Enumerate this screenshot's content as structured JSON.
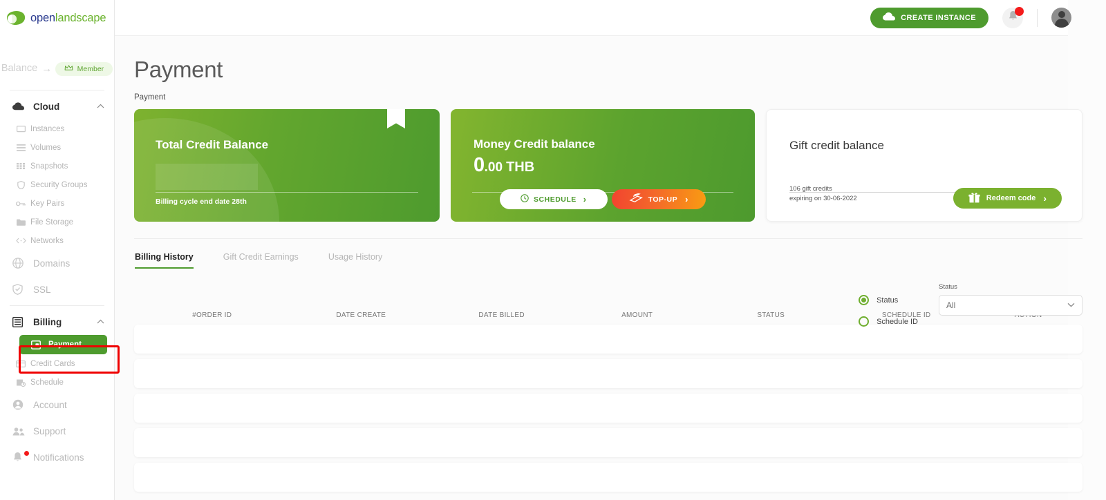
{
  "brand": {
    "name_part1": "open",
    "name_part2": "landscape"
  },
  "sidebar": {
    "balance_label": "Balance",
    "balance_arrow": "→",
    "member_label": "Member",
    "groups": [
      {
        "label": "Cloud",
        "icon": "cloud-icon",
        "items": [
          {
            "label": "Instances",
            "icon": "monitor-icon"
          },
          {
            "label": "Volumes",
            "icon": "list-icon"
          },
          {
            "label": "Snapshots",
            "icon": "grid-icon"
          },
          {
            "label": "Security Groups",
            "icon": "shield-icon"
          },
          {
            "label": "Key Pairs",
            "icon": "key-icon"
          },
          {
            "label": "File Storage",
            "icon": "folder-icon"
          },
          {
            "label": "Networks",
            "icon": "code-icon"
          }
        ]
      },
      {
        "label": "Domains",
        "icon": "globe-icon",
        "items": []
      },
      {
        "label": "SSL",
        "icon": "shield-check-icon",
        "items": []
      },
      {
        "label": "Billing",
        "icon": "billing-icon",
        "items": [
          {
            "label": "Payment",
            "icon": "wallet-icon",
            "active": true
          },
          {
            "label": "Credit Cards",
            "icon": "card-icon"
          },
          {
            "label": "Schedule",
            "icon": "calendar-clock-icon"
          }
        ]
      },
      {
        "label": "Account",
        "icon": "user-icon",
        "items": []
      },
      {
        "label": "Support",
        "icon": "people-icon",
        "items": []
      },
      {
        "label": "Notifications",
        "icon": "bell-icon",
        "items": []
      }
    ]
  },
  "topbar": {
    "create_instance_label": "CREATE INSTANCE",
    "bell_icon": "bell-icon",
    "avatar_icon": "avatar-icon",
    "chevron_icon": "chevron-down-icon"
  },
  "page": {
    "title": "Payment",
    "breadcrumb": "Payment"
  },
  "cards": {
    "total_credit": {
      "title": "Total Credit Balance",
      "amount": "",
      "footer": "Billing cycle end date 28th",
      "ribbon_icon": "bookmark-icon"
    },
    "money_credit": {
      "title": "Money Credit balance",
      "amount_int": "0",
      "amount_dec": ".00",
      "currency": "THB",
      "schedule_label": "SCHEDULE",
      "schedule_icon": "clock-icon",
      "schedule_arrow": "›",
      "topup_label": "TOP-UP",
      "topup_icon": "credit-card-icon",
      "topup_arrow": "›"
    },
    "gift_credit": {
      "title": "Gift credit balance",
      "credits_line": "106 gift credits",
      "expiry_line": "expiring on 30-06-2022",
      "redeem_label": "Redeem code",
      "redeem_icon": "gift-icon",
      "redeem_arrow": "›"
    }
  },
  "tabs": [
    {
      "label": "Billing History",
      "active": true
    },
    {
      "label": "Gift Credit Earnings",
      "active": false
    },
    {
      "label": "Usage History",
      "active": false
    }
  ],
  "filters": {
    "radios": [
      {
        "label": "Status",
        "selected": true
      },
      {
        "label": "Schedule ID",
        "selected": false
      }
    ],
    "select": {
      "label": "Status",
      "value": "All",
      "caret_icon": "chevron-down-icon"
    }
  },
  "table": {
    "columns": [
      "#ORDER ID",
      "DATE CREATE",
      "DATE BILLED",
      "AMOUNT",
      "STATUS",
      "SCHEDULE ID",
      "ACTION"
    ],
    "rows": [
      [],
      [],
      [],
      [],
      []
    ]
  },
  "colors": {
    "brand_green": "#4e9b2e",
    "accent_light_green": "#7bb12f",
    "alert_red": "#f41b1b",
    "highlight_red": "#ef0000",
    "topup_gradient_start": "#f1442f",
    "topup_gradient_end": "#f99c12",
    "logo_blue": "#2b3b8f"
  }
}
